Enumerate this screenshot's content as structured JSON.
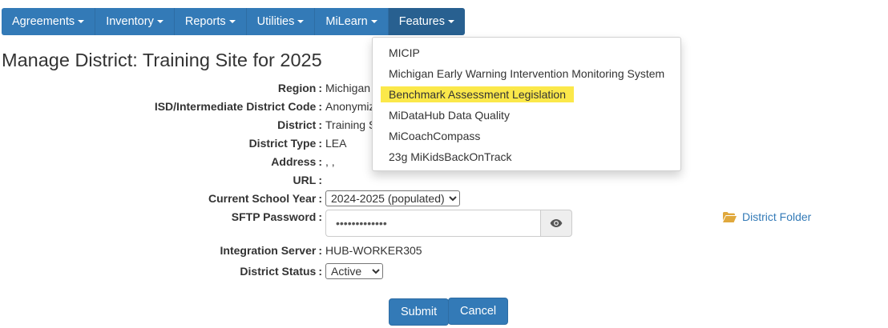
{
  "navbar": {
    "items": [
      {
        "label": "Agreements"
      },
      {
        "label": "Inventory"
      },
      {
        "label": "Reports"
      },
      {
        "label": "Utilities"
      },
      {
        "label": "MiLearn"
      },
      {
        "label": "Features"
      }
    ]
  },
  "features_menu": {
    "items": [
      {
        "label": "MICIP"
      },
      {
        "label": "Michigan Early Warning Intervention Monitoring System"
      },
      {
        "label": "Benchmark Assessment Legislation"
      },
      {
        "label": "MiDataHub Data Quality"
      },
      {
        "label": "MiCoachCompass"
      },
      {
        "label": "23g MiKidsBackOnTrack"
      }
    ],
    "highlight_color": "#fbe84a"
  },
  "page": {
    "title": "Manage District: Training Site for 2025"
  },
  "form": {
    "region_label": "Region",
    "region_value": "Michigan",
    "isd_label": "ISD/Intermediate District Code",
    "isd_value": "Anonymiz",
    "district_label": "District",
    "district_value": "Training S",
    "district_type_label": "District Type",
    "district_type_value": "LEA",
    "address_label": "Address",
    "address_value": ", ,",
    "url_label": "URL",
    "url_value": "",
    "school_year_label": "Current School Year",
    "school_year_value": "2024-2025 (populated)",
    "sftp_label": "SFTP Password",
    "sftp_value": "•••••••••••••",
    "integration_label": "Integration Server",
    "integration_value": "HUB-WORKER305",
    "status_label": "District Status",
    "status_value": "Active",
    "district_folder_link": "District Folder",
    "colon": ":"
  },
  "buttons": {
    "submit": "Submit",
    "cancel": "Cancel"
  },
  "colors": {
    "primary": "#337ab7",
    "primary_active": "#286090",
    "folder_icon": "#e0a83c"
  }
}
